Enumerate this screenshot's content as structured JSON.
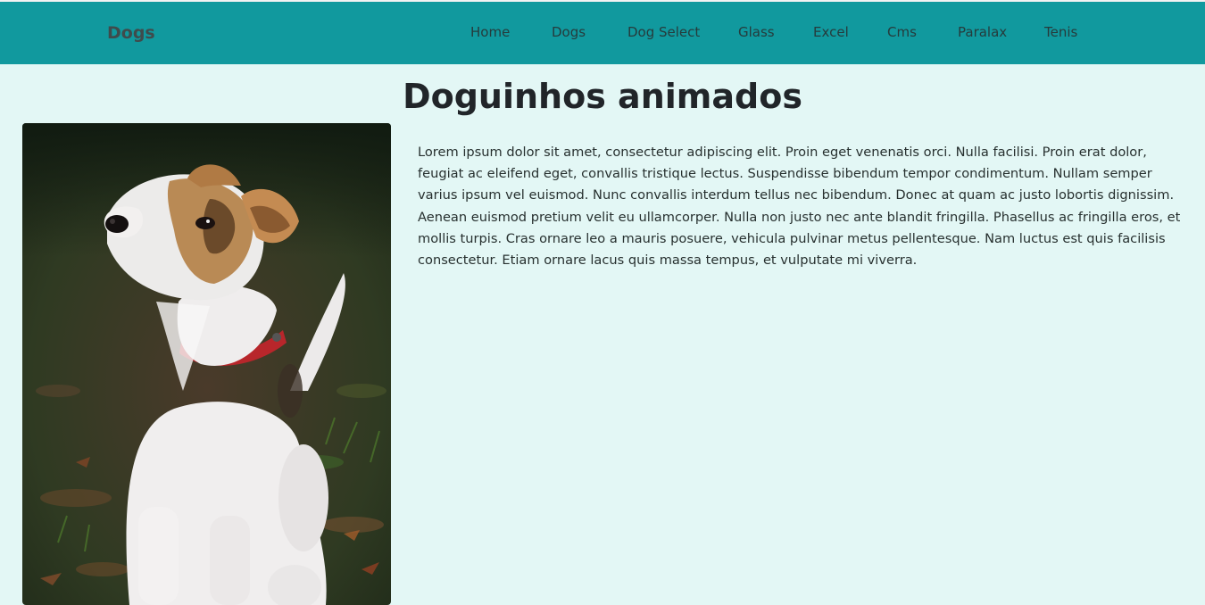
{
  "navbar": {
    "brand": "Dogs",
    "links": [
      "Home",
      "Dogs",
      "Dog Select",
      "Glass",
      "Excel",
      "Cms",
      "Paralax",
      "Tenis"
    ]
  },
  "main": {
    "title": "Doguinhos animados",
    "image_alt": "puppy photo",
    "paragraph": "Lorem ipsum dolor sit amet, consectetur adipiscing elit. Proin eget venenatis orci. Nulla facilisi. Proin erat dolor, feugiat ac eleifend eget, convallis tristique lectus. Suspendisse bibendum tempor condimentum. Nullam semper varius ipsum vel euismod. Nunc convallis interdum tellus nec bibendum. Donec at quam ac justo lobortis dignissim. Aenean euismod pretium velit eu ullamcorper. Nulla non justo nec ante blandit fringilla. Phasellus ac fringilla eros, et mollis turpis. Cras ornare leo a mauris posuere, vehicula pulvinar metus pellentesque. Nam luctus est quis facilisis consectetur. Etiam ornare lacus quis massa tempus, et vulputate mi viverra."
  },
  "colors": {
    "navbar": "#11999e",
    "background": "#e3f7f5",
    "text": "#212529"
  }
}
